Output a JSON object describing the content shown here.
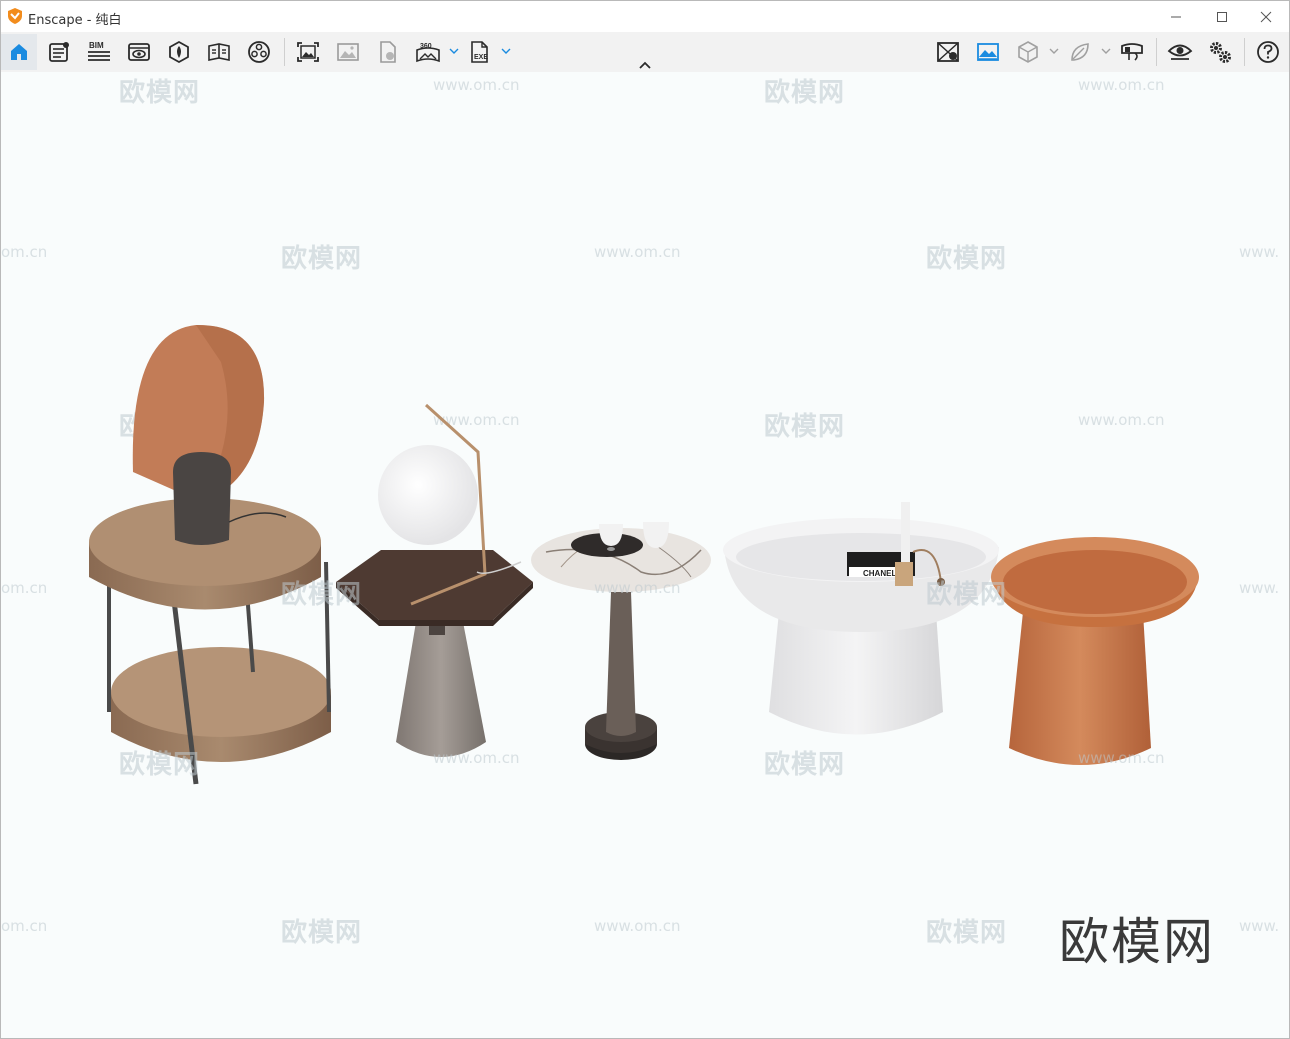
{
  "window": {
    "title": "Enscape - 纯白",
    "controls": [
      "minimize",
      "maximize",
      "close"
    ]
  },
  "toolbar": {
    "left_tools": [
      {
        "name": "home-icon",
        "active": true
      },
      {
        "name": "project-notes-icon"
      },
      {
        "name": "bim-icon",
        "label": "BIM"
      },
      {
        "name": "view-management-icon"
      },
      {
        "name": "visual-settings-icon"
      },
      {
        "name": "asset-library-icon"
      },
      {
        "name": "material-editor-icon"
      },
      {
        "name": "screenshot-icon"
      },
      {
        "name": "batch-rendering-icon"
      },
      {
        "name": "export-upload-icon"
      },
      {
        "name": "panorama-360-icon",
        "label": "360",
        "dropdown": true
      },
      {
        "name": "export-exe-icon",
        "label": "EXE",
        "dropdown": true
      }
    ],
    "right_tools": [
      {
        "name": "live-update-icon"
      },
      {
        "name": "sky-landscape-icon"
      },
      {
        "name": "section-box-icon",
        "dropdown": true
      },
      {
        "name": "leaf-vegetation-icon",
        "dropdown": true
      },
      {
        "name": "vr-headset-icon"
      },
      {
        "name": "eye-visibility-icon"
      },
      {
        "name": "settings-gears-icon"
      },
      {
        "name": "help-icon"
      }
    ],
    "accent": "#1a8be0"
  },
  "viewport": {
    "background": "#f9fcfc",
    "watermarks": {
      "cn": "欧模网",
      "url": "www.om.cn",
      "url_partial_left": "om.cn",
      "url_partial_right": "www.",
      "logo": "欧模网"
    },
    "scene_labels": {
      "book_label": "CHANEL"
    },
    "scene_objects": [
      "round wood side table with oval mirror and lamp",
      "hexagon table with globe lamp",
      "marble round table with cups",
      "white bowl coffee table",
      "terracotta bowl side table"
    ]
  },
  "colors": {
    "logo_orange": "#f28c1c",
    "home_blue": "#1a8be0",
    "icon_dark": "#2b2b2b",
    "terracotta": "#c97a4e",
    "wood": "#9a7458"
  }
}
